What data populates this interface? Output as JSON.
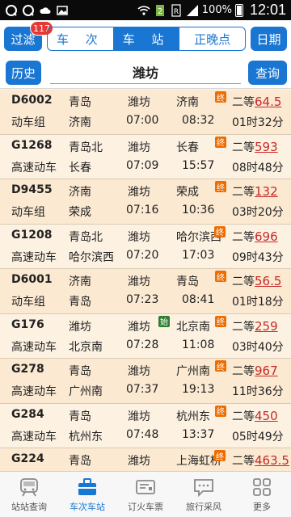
{
  "statusbar": {
    "battery": "100%",
    "time": "12:01"
  },
  "topnav": {
    "filter_label": "过滤",
    "filter_badge": "117",
    "segments": [
      "车 次",
      "车 站",
      "正晚点"
    ],
    "active_segment": 1,
    "date_label": "日期"
  },
  "search": {
    "history_label": "历史",
    "station": "潍坊",
    "query_label": "查询"
  },
  "trains": [
    {
      "code": "D6002",
      "type": "动车组",
      "from": "青岛",
      "station": "潍坊",
      "to": "济南",
      "origin": "济南",
      "dep": "07:00",
      "arr": "08:32",
      "seat": "二等",
      "price": "64.5",
      "duration": "01时32分",
      "tag": "终"
    },
    {
      "code": "G1268",
      "type": "高速动车",
      "from": "青岛北",
      "station": "潍坊",
      "to": "长春",
      "origin": "长春",
      "dep": "07:09",
      "arr": "15:57",
      "seat": "二等",
      "price": "593",
      "duration": "08时48分",
      "tag": "终"
    },
    {
      "code": "D9455",
      "type": "动车组",
      "from": "济南",
      "station": "潍坊",
      "to": "荣成",
      "origin": "荣成",
      "dep": "07:16",
      "arr": "10:36",
      "seat": "二等",
      "price": "132",
      "duration": "03时20分",
      "tag": "终"
    },
    {
      "code": "G1208",
      "type": "高速动车",
      "from": "青岛北",
      "station": "潍坊",
      "to": "哈尔滨西",
      "origin": "哈尔滨西",
      "dep": "07:20",
      "arr": "17:03",
      "seat": "二等",
      "price": "696",
      "duration": "09时43分",
      "tag": "终"
    },
    {
      "code": "D6001",
      "type": "动车组",
      "from": "济南",
      "station": "潍坊",
      "to": "青岛",
      "origin": "青岛",
      "dep": "07:23",
      "arr": "08:41",
      "seat": "二等",
      "price": "56.5",
      "duration": "01时18分",
      "tag": "终"
    },
    {
      "code": "G176",
      "type": "高速动车",
      "from": "潍坊",
      "station": "潍坊",
      "to": "北京南",
      "origin": "北京南",
      "dep": "07:28",
      "arr": "11:08",
      "seat": "二等",
      "price": "259",
      "duration": "03时40分",
      "tag": "终",
      "start_tag": "始"
    },
    {
      "code": "G278",
      "type": "高速动车",
      "from": "青岛",
      "station": "潍坊",
      "to": "广州南",
      "origin": "广州南",
      "dep": "07:37",
      "arr": "19:13",
      "seat": "二等",
      "price": "967",
      "duration": "11时36分",
      "tag": "终"
    },
    {
      "code": "G284",
      "type": "高速动车",
      "from": "青岛",
      "station": "潍坊",
      "to": "杭州东",
      "origin": "杭州东",
      "dep": "07:48",
      "arr": "13:37",
      "seat": "二等",
      "price": "450",
      "duration": "05时49分",
      "tag": "终"
    },
    {
      "code": "G224",
      "type": "",
      "from": "青岛",
      "station": "潍坊",
      "to": "上海虹桥",
      "origin": "",
      "dep": "",
      "arr": "",
      "seat": "二等",
      "price": "463.5",
      "duration": "",
      "tag": "终"
    }
  ],
  "tabs": [
    {
      "label": "站站查询",
      "icon": "train-icon"
    },
    {
      "label": "车次车站",
      "icon": "briefcase-icon"
    },
    {
      "label": "订火车票",
      "icon": "ticket-icon"
    },
    {
      "label": "旅行采风",
      "icon": "chat-bubble-icon"
    },
    {
      "label": "更多",
      "icon": "grid-icon"
    }
  ],
  "active_tab": 1,
  "colors": {
    "accent": "#1976d2",
    "price": "#c62828",
    "row_odd": "#fbe9d2",
    "row_even": "#fdf2e2",
    "tag_end": "#ef6c00",
    "tag_start": "#2e7d32"
  }
}
